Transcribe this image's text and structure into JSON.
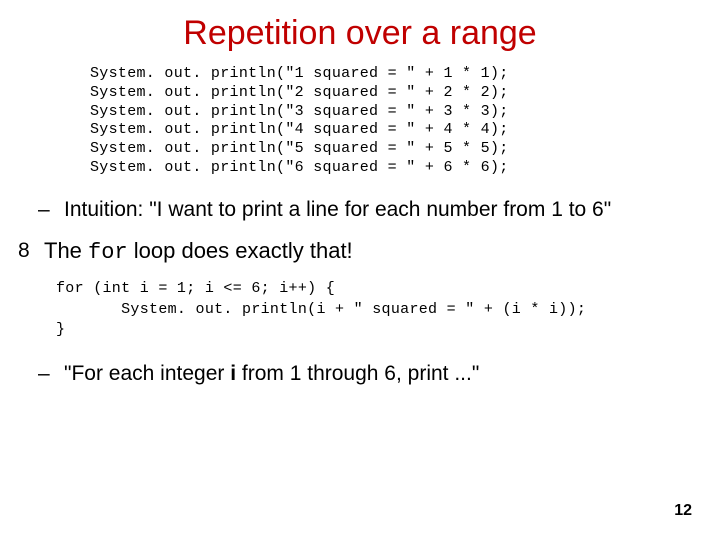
{
  "title": "Repetition over a range",
  "code1_line1": "System. out. println(\"1 squared = \" + 1 * 1);",
  "code1_line2": "System. out. println(\"2 squared = \" + 2 * 2);",
  "code1_line3": "System. out. println(\"3 squared = \" + 3 * 3);",
  "code1_line4": "System. out. println(\"4 squared = \" + 4 * 4);",
  "code1_line5": "System. out. println(\"5 squared = \" + 5 * 5);",
  "code1_line6": "System. out. println(\"6 squared = \" + 6 * 6);",
  "intuition_dash": "–",
  "intuition_text": "Intuition: \"I want to print a line for each number from 1 to 6\"",
  "for_bullet": "8",
  "for_text_1": "The ",
  "for_code": "for",
  "for_text_2": " loop does exactly that!",
  "code2_line1": "for (int i = 1; i <= 6; i++) {",
  "code2_line2": "       System. out. println(i + \" squared = \" + (i * i));",
  "code2_line3": "}",
  "each_dash": "–",
  "each_text_1": "\"For each integer ",
  "each_bold": "i",
  "each_text_2": " from 1 through 6, print ...\"",
  "page_number": "12"
}
